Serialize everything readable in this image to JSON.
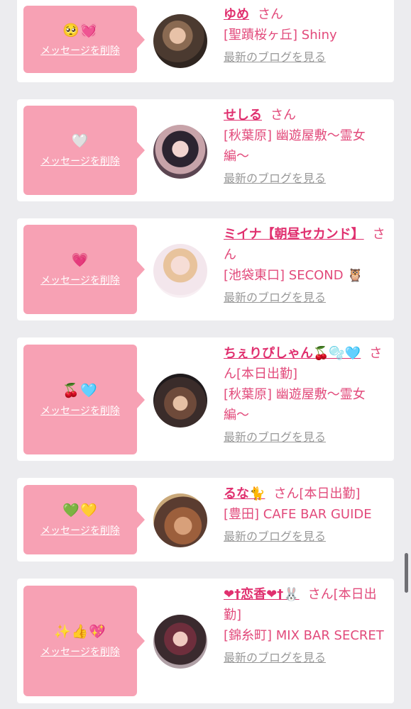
{
  "delete_label": "メッセージを削除",
  "blog_label": "最新のブログを見る",
  "honorific": "さん",
  "cards": [
    {
      "name": "ゆめ",
      "after": "",
      "shop": "[聖蹟桜ヶ丘] Shiny",
      "message": "🥺💓"
    },
    {
      "name": "せしる",
      "after": "",
      "shop": "[秋葉原] 幽遊屋敷〜霊女編〜",
      "message": "🤍"
    },
    {
      "name": "ミイナ【朝昼セカンド】",
      "after": "",
      "shop": "[池袋東口] SECOND 🦉",
      "message": "💗"
    },
    {
      "name": "ちぇりぴしゃん🍒🫧🩵",
      "after": "[本日出勤]",
      "shop": "[秋葉原] 幽遊屋敷〜霊女編〜",
      "message": "🍒🩵"
    },
    {
      "name": "るな🐈",
      "after": "[本日出勤]",
      "shop": "[豊田] CAFE BAR GUIDE",
      "message": "💚💛"
    },
    {
      "name": "❤†恋香❤†🐰",
      "after": "[本日出勤]",
      "shop": "[錦糸町] MIX BAR SECRET",
      "message": "✨👍💖"
    }
  ],
  "colors": {
    "background": "#ececef",
    "bubble": "#f7a1b4",
    "name": "#e0306f",
    "text": "#e24a7b",
    "muted": "#999999"
  }
}
